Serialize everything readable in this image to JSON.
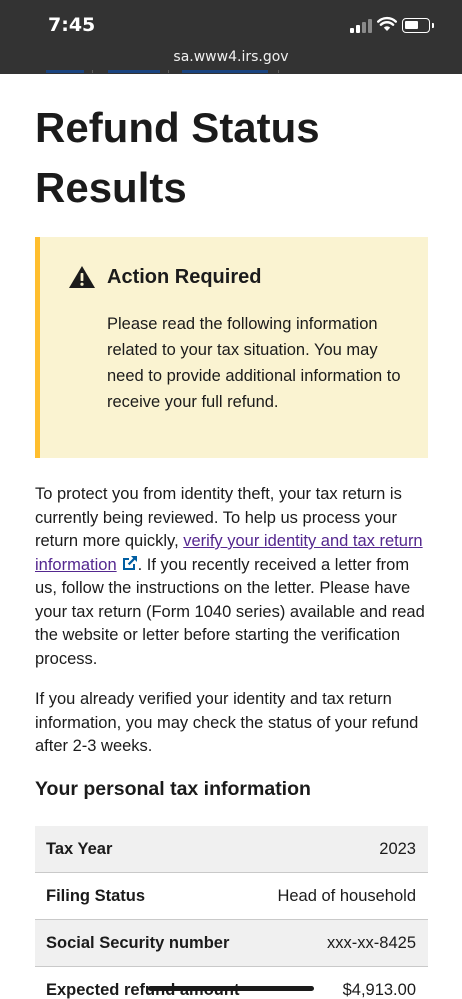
{
  "status_bar": {
    "time": "7:45",
    "url": "sa.www4.irs.gov"
  },
  "page": {
    "title": "Refund Status Results"
  },
  "alert": {
    "heading": "Action Required",
    "body": "Please read the following information related to your tax situation. You may need to provide additional information to receive your full refund.",
    "icon": "warning-icon",
    "colors": {
      "background": "#faf3d1",
      "border": "#ffbe2e"
    }
  },
  "identity_paragraph": {
    "before_link": "To protect you from identity theft, your tax return is currently being reviewed. To help us process your return more quickly, ",
    "link_text": "verify your identity and tax return information",
    "after_link": ". If you recently received a letter from us, follow the instructions on the letter. Please have your tax return (Form 1040 series) available and read the website or letter before starting the verification process."
  },
  "verified_paragraph": {
    "text": "If you already verified your identity and tax return information, you may check the status of your refund after 2-3 weeks."
  },
  "tax_info": {
    "heading": "Your personal tax information",
    "rows": [
      {
        "label": "Tax Year",
        "value": "2023"
      },
      {
        "label": "Filing Status",
        "value": "Head of household"
      },
      {
        "label": "Social Security number",
        "value": "xxx-xx-8425"
      },
      {
        "label": "Expected refund amount",
        "value": "$4,913.00"
      }
    ]
  },
  "colors": {
    "link": "#54278f",
    "external_icon": "#005ea2",
    "status_bar": "#333333"
  }
}
